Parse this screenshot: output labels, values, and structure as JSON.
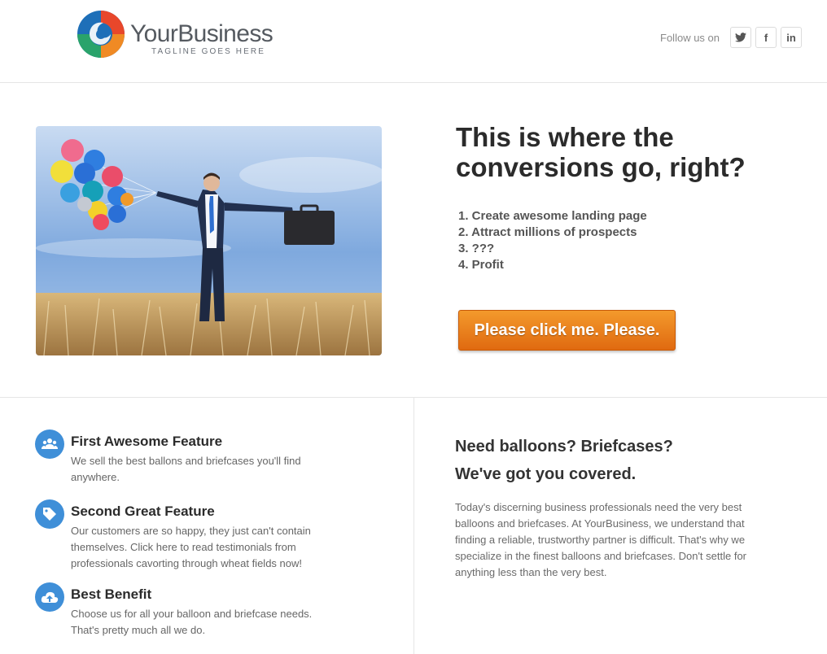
{
  "header": {
    "logo": {
      "name": "YourBusiness",
      "tagline": "TAGLINE GOES HERE"
    },
    "follow_label": "Follow us on",
    "social": [
      {
        "icon": "twitter-icon",
        "label": ""
      },
      {
        "icon": "facebook-icon",
        "label": "f"
      },
      {
        "icon": "linkedin-icon",
        "label": "in"
      }
    ]
  },
  "hero": {
    "image_alt": "businessman-with-balloons-photo",
    "title": "This is where the conversions go, right?",
    "steps": [
      "1. Create awesome landing page",
      "2. Attract millions of prospects",
      "3. ???",
      "4. Profit"
    ],
    "cta_label": "Please click me. Please."
  },
  "features": [
    {
      "icon": "users-icon",
      "title": "First Awesome Feature",
      "text": "We sell the best ballons and briefcases you'll find anywhere."
    },
    {
      "icon": "tag-icon",
      "title": "Second Great Feature",
      "text": "Our customers are so happy, they just can't contain themselves. Click here to read testimonials from professionals cavorting through wheat fields now!"
    },
    {
      "icon": "cloud-upload-icon",
      "title": "Best Benefit",
      "text": "Choose us for all your balloon and briefcase needs. That's pretty much all we do."
    }
  ],
  "side": {
    "title_line1": "Need balloons? Briefcases?",
    "title_line2": "We've got you covered.",
    "text": "Today's discerning business professionals need the very best balloons and briefcases. At YourBusiness, we understand that finding a reliable, trustworthy partner is difficult. That's why we specialize in the finest balloons and briefcases. Don't settle for anything less than the very best."
  },
  "colors": {
    "accent_blue": "#3f8fd8",
    "cta_orange": "#e97f1c",
    "text_dark": "#2b2b2b",
    "text_muted": "#666666"
  }
}
